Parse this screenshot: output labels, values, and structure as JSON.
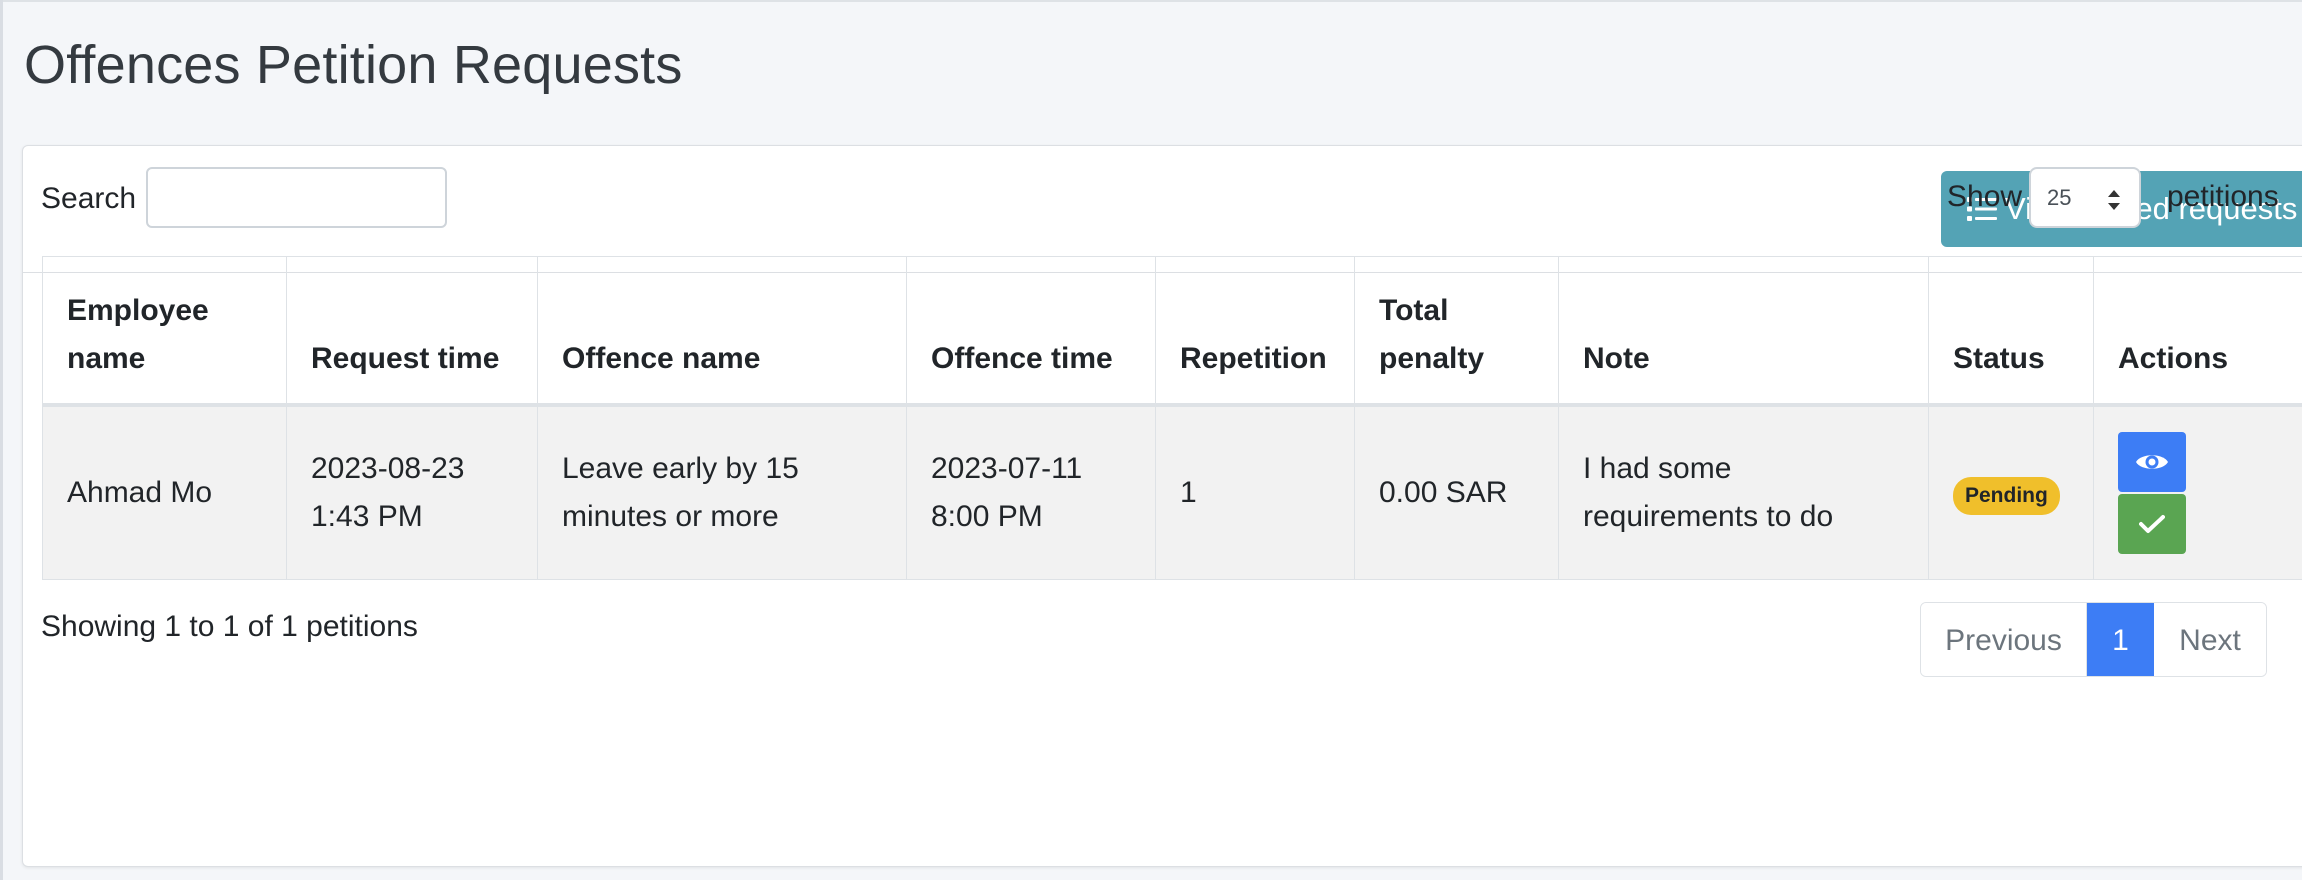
{
  "page": {
    "title": "Offences Petition Requests"
  },
  "header": {
    "view_closed_label": "View closed requests",
    "view_closed_icon": "list-icon"
  },
  "controls": {
    "search_label": "Search",
    "search_value": "",
    "show_label": "Show",
    "page_size": "25",
    "petitions_label": "petitions"
  },
  "table": {
    "headers": {
      "employee": "Employee name",
      "request_time": "Request time",
      "offence_name": "Offence name",
      "offence_time": "Offence time",
      "repetition": "Repetition",
      "total_penalty": "Total penalty",
      "note": "Note",
      "status": "Status",
      "actions": "Actions"
    },
    "rows": [
      {
        "employee": "Ahmad Mo",
        "request_time": "2023-08-23 1:43 PM",
        "offence_name": "Leave early by 15 minutes or more",
        "offence_time": "2023-07-11 8:00 PM",
        "repetition": "1",
        "total_penalty": "0.00 SAR",
        "note": "I had some requirements to do",
        "status": "Pending",
        "view_icon": "eye-icon",
        "approve_icon": "check-icon"
      }
    ]
  },
  "footer": {
    "info": "Showing 1 to 1 of 1 petitions",
    "prev_label": "Previous",
    "current_page": "1",
    "next_label": "Next"
  },
  "colors": {
    "accent_teal": "#54a3b5",
    "primary_blue": "#3d7df5",
    "success_green": "#5aa552",
    "pending_yellow": "#f0bf2b"
  }
}
